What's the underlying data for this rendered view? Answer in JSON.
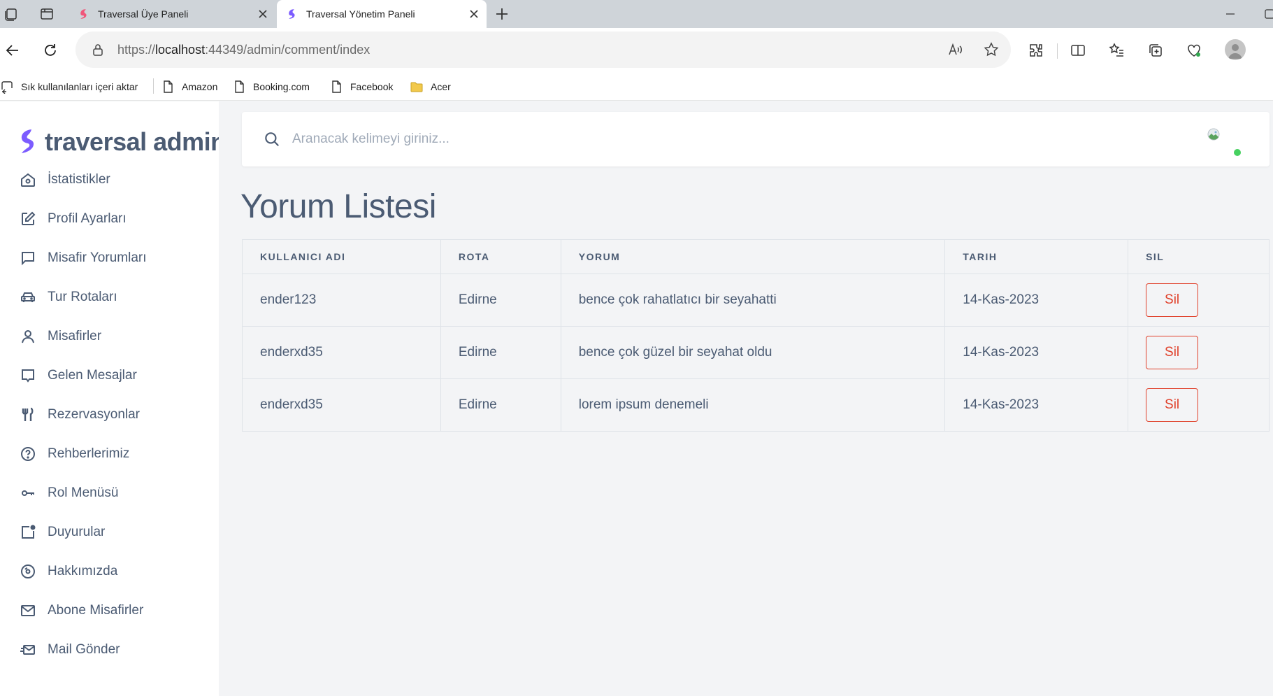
{
  "browser": {
    "tabs": [
      {
        "title": "Traversal Üye Paneli"
      },
      {
        "title": "Traversal Yönetim Paneli"
      }
    ],
    "address": {
      "scheme": "https://",
      "host": "localhost",
      "path": ":44349/admin/comment/index"
    },
    "bookmarks": [
      {
        "label": "Sık kullanılanları içeri aktar",
        "icon": "import-favorites-icon"
      },
      {
        "label": "Amazon",
        "icon": "page-icon"
      },
      {
        "label": "Booking.com",
        "icon": "page-icon"
      },
      {
        "label": "Facebook",
        "icon": "page-icon"
      },
      {
        "label": "Acer",
        "icon": "folder-icon"
      }
    ]
  },
  "brand": {
    "name": "traversal admin",
    "accent": "#7c5cff"
  },
  "sidebar": {
    "items": [
      {
        "label": "İstatistikler",
        "icon": "home-icon"
      },
      {
        "label": "Profil Ayarları",
        "icon": "edit-icon"
      },
      {
        "label": "Misafir Yorumları",
        "icon": "message-square-icon"
      },
      {
        "label": "Tur Rotaları",
        "icon": "car-icon"
      },
      {
        "label": "Misafirler",
        "icon": "user-icon"
      },
      {
        "label": "Gelen Mesajlar",
        "icon": "message-icon"
      },
      {
        "label": "Rezervasyonlar",
        "icon": "utensils-icon"
      },
      {
        "label": "Rehberlerimiz",
        "icon": "help-circle-icon"
      },
      {
        "label": "Rol Menüsü",
        "icon": "key-icon"
      },
      {
        "label": "Duyurular",
        "icon": "notification-icon"
      },
      {
        "label": "Hakkımızda",
        "icon": "disc-icon"
      },
      {
        "label": "Abone Misafirler",
        "icon": "mail-icon"
      },
      {
        "label": "Mail Gönder",
        "icon": "send-mail-icon"
      }
    ]
  },
  "search": {
    "placeholder": "Aranacak kelimeyi giriniz..."
  },
  "main": {
    "title": "Yorum Listesi",
    "table": {
      "headers": [
        "KULLANICI ADI",
        "ROTA",
        "YORUM",
        "TARIH",
        "SIL"
      ],
      "rows": [
        {
          "user": "ender123",
          "route": "Edirne",
          "comment": "bence çok rahatlatıcı bir seyahatti",
          "date": "14-Kas-2023",
          "action": "Sil"
        },
        {
          "user": "enderxd35",
          "route": "Edirne",
          "comment": "bence çok güzel bir seyahat oldu",
          "date": "14-Kas-2023",
          "action": "Sil"
        },
        {
          "user": "enderxd35",
          "route": "Edirne",
          "comment": "lorem ipsum denemeli",
          "date": "14-Kas-2023",
          "action": "Sil"
        }
      ]
    }
  },
  "colors": {
    "text": "#4b5b73",
    "danger": "#e0412b",
    "online": "#46d160"
  }
}
